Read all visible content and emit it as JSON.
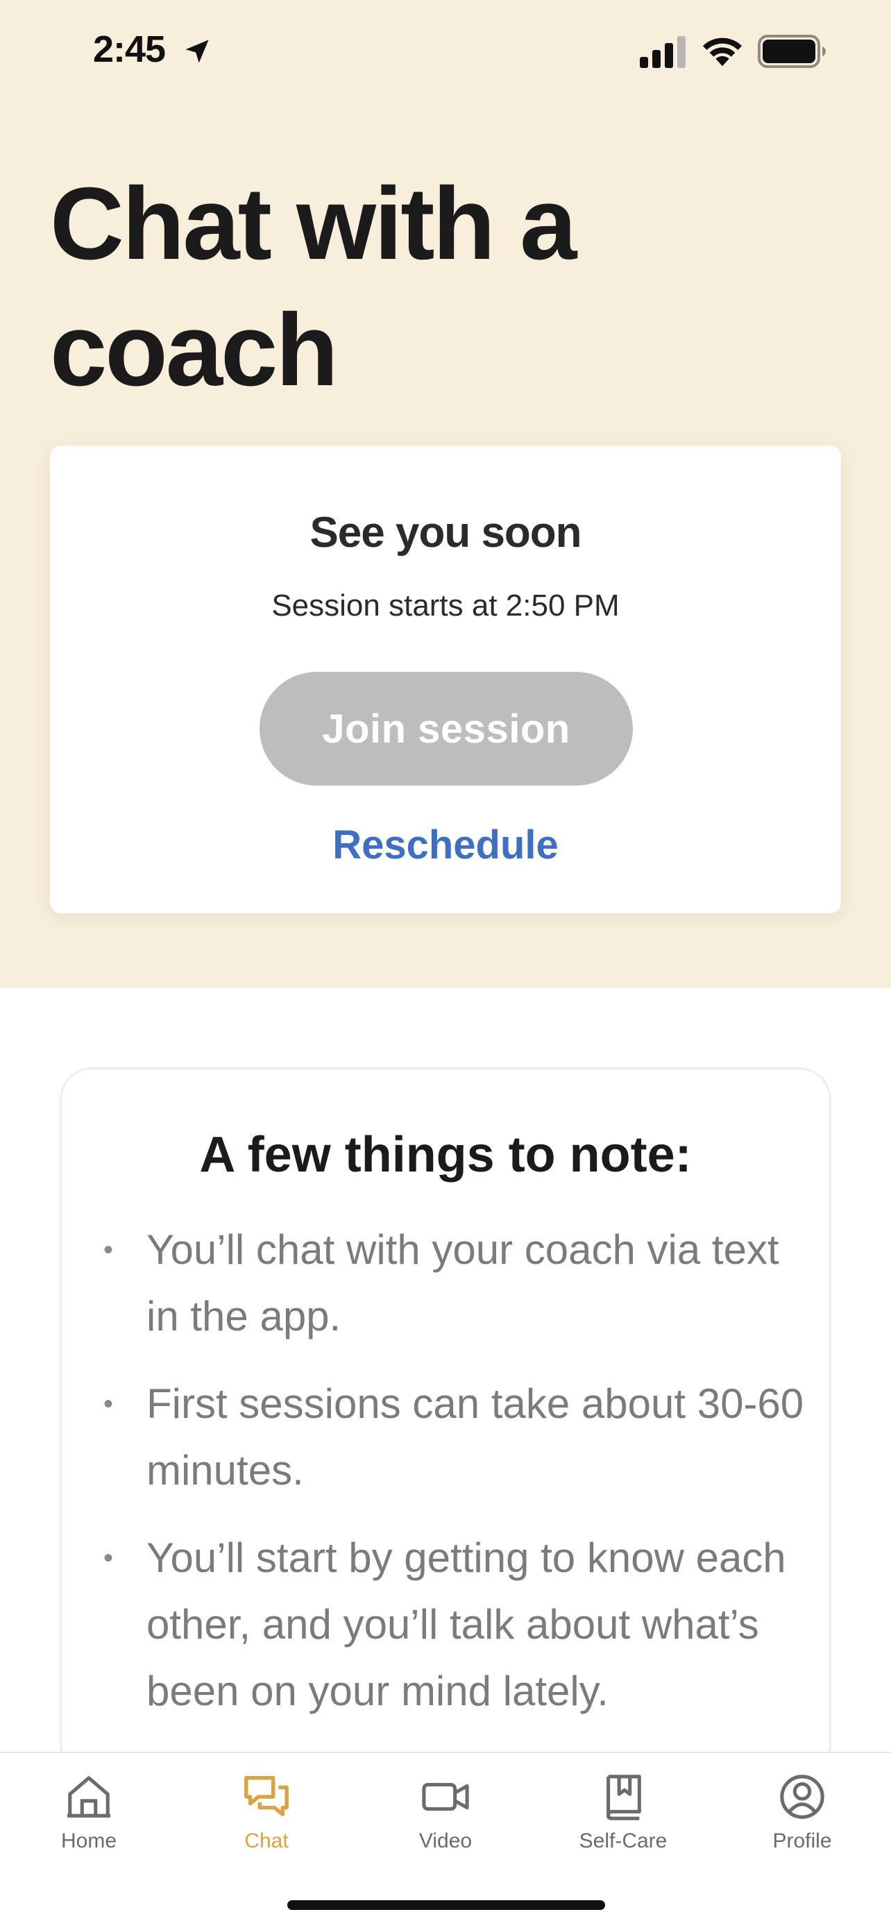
{
  "status_bar": {
    "time": "2:45",
    "icons": [
      "location-arrow-icon",
      "cellular-signal-icon",
      "wifi-icon",
      "battery-icon"
    ]
  },
  "header": {
    "title": "Chat with a coach"
  },
  "session_card": {
    "heading": "See you soon",
    "time_text": "Session starts at 2:50 PM",
    "join_label": "Join session",
    "join_enabled": false,
    "reschedule_label": "Reschedule"
  },
  "notes": {
    "heading": "A few things to note:",
    "items": [
      "You’ll chat with your coach via text in the app.",
      "First sessions can take about 30-60 minutes.",
      "You’ll start by getting to know each other, and you’ll talk about what’s been on your mind lately."
    ]
  },
  "tab_bar": {
    "active": "Chat",
    "tabs": [
      {
        "label": "Home",
        "icon": "home-icon"
      },
      {
        "label": "Chat",
        "icon": "chat-bubbles-icon"
      },
      {
        "label": "Video",
        "icon": "video-camera-icon"
      },
      {
        "label": "Self-Care",
        "icon": "bookmark-book-icon"
      },
      {
        "label": "Profile",
        "icon": "profile-icon"
      }
    ]
  },
  "colors": {
    "hero_background": "#f7efdb",
    "accent_active_tab": "#d9a441",
    "link_blue": "#3e6fc0",
    "disabled_button": "#bdbdbd"
  }
}
